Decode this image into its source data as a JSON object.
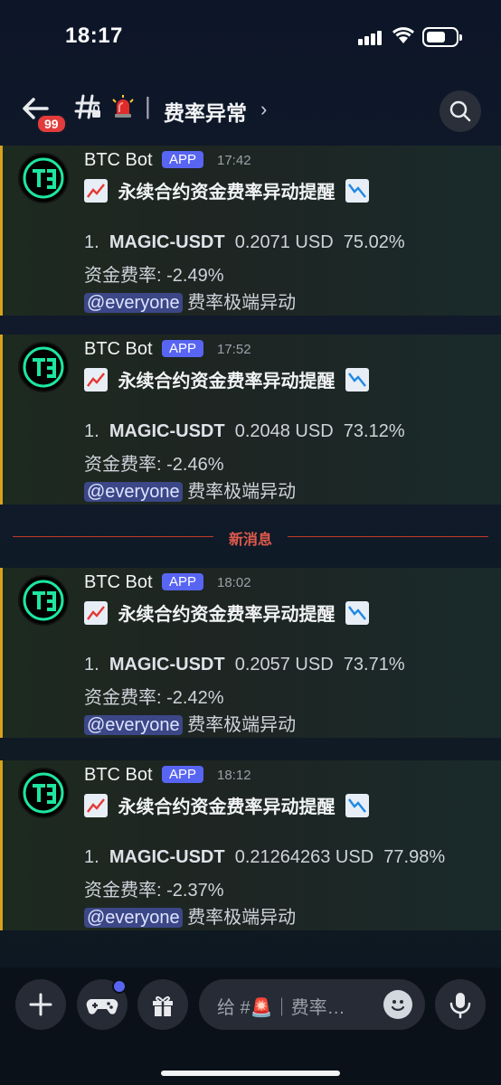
{
  "status_bar": {
    "time": "18:17"
  },
  "header": {
    "unread_count": "99",
    "channel_separator": "|",
    "channel_name": "费率异常",
    "chevron": "›"
  },
  "new_messages_divider": "新消息",
  "messages": [
    {
      "author": "BTC Bot",
      "tag": "APP",
      "time": "17:42",
      "title": "永续合约资金费率异动提醒",
      "index": "1.",
      "symbol": "MAGIC-USDT",
      "price": "0.2071 USD",
      "percent": "75.02%",
      "rate": "资金费率: -2.49%",
      "mention": "@everyone",
      "ping_text": "费率极端异动"
    },
    {
      "author": "BTC Bot",
      "tag": "APP",
      "time": "17:52",
      "title": "永续合约资金费率异动提醒",
      "index": "1.",
      "symbol": "MAGIC-USDT",
      "price": "0.2048 USD",
      "percent": "73.12%",
      "rate": "资金费率: -2.46%",
      "mention": "@everyone",
      "ping_text": "费率极端异动"
    },
    {
      "author": "BTC Bot",
      "tag": "APP",
      "time": "18:02",
      "title": "永续合约资金费率异动提醒",
      "index": "1.",
      "symbol": "MAGIC-USDT",
      "price": "0.2057 USD",
      "percent": "73.71%",
      "rate": "资金费率: -2.42%",
      "mention": "@everyone",
      "ping_text": "费率极端异动"
    },
    {
      "author": "BTC Bot",
      "tag": "APP",
      "time": "18:12",
      "title": "永续合约资金费率异动提醒",
      "index": "1.",
      "symbol": "MAGIC-USDT",
      "price": "0.21264263 USD",
      "percent": "77.98%",
      "rate": "资金费率: -2.37%",
      "mention": "@everyone",
      "ping_text": "费率极端异动"
    }
  ],
  "composer": {
    "placeholder": "给 #🚨｜费率…"
  },
  "colors": {
    "accent": "#5865f2",
    "badge": "#e23c3c",
    "highlight_bar": "#d8a21a",
    "divider": "#c0392b"
  },
  "icons": [
    "back-arrow-icon",
    "hash-icon",
    "siren-icon",
    "search-icon",
    "plus-icon",
    "gamepad-icon",
    "gift-icon",
    "emoji-icon",
    "mic-icon",
    "chart-up-icon",
    "chart-down-icon"
  ]
}
